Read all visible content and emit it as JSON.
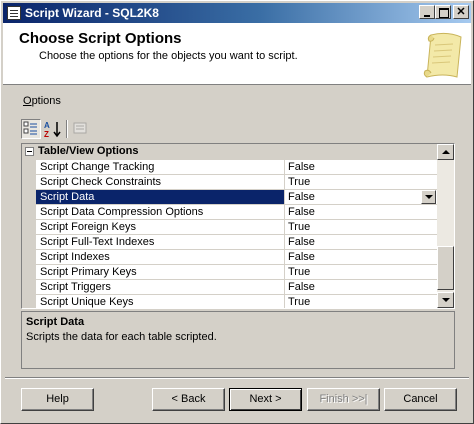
{
  "window": {
    "title": "Script Wizard - SQL2K8"
  },
  "header": {
    "title": "Choose Script Options",
    "subtitle": "Choose the options for the objects you want to script."
  },
  "options_label": {
    "mnemonic": "O",
    "rest": "ptions"
  },
  "toolbar": {
    "icons": [
      "categorized-icon",
      "alphabetical-icon",
      "property-pages-icon"
    ]
  },
  "grid": {
    "category": "Table/View Options",
    "rows": [
      {
        "name": "Script Change Tracking",
        "value": "False"
      },
      {
        "name": "Script Check Constraints",
        "value": "True"
      },
      {
        "name": "Script Data",
        "value": "False"
      },
      {
        "name": "Script Data Compression Options",
        "value": "False"
      },
      {
        "name": "Script Foreign Keys",
        "value": "True"
      },
      {
        "name": "Script Full-Text Indexes",
        "value": "False"
      },
      {
        "name": "Script Indexes",
        "value": "False"
      },
      {
        "name": "Script Primary Keys",
        "value": "True"
      },
      {
        "name": "Script Triggers",
        "value": "False"
      },
      {
        "name": "Script Unique Keys",
        "value": "True"
      }
    ],
    "selected_index": 2
  },
  "description": {
    "title": "Script Data",
    "text": "Scripts the data for each table scripted."
  },
  "buttons": {
    "help": "Help",
    "back": "< Back",
    "next": "Next >",
    "finish": "Finish >>|",
    "cancel": "Cancel"
  },
  "colors": {
    "title_bar": "#0a246a",
    "selection": "#0a246a",
    "face": "#d4d0c8"
  }
}
